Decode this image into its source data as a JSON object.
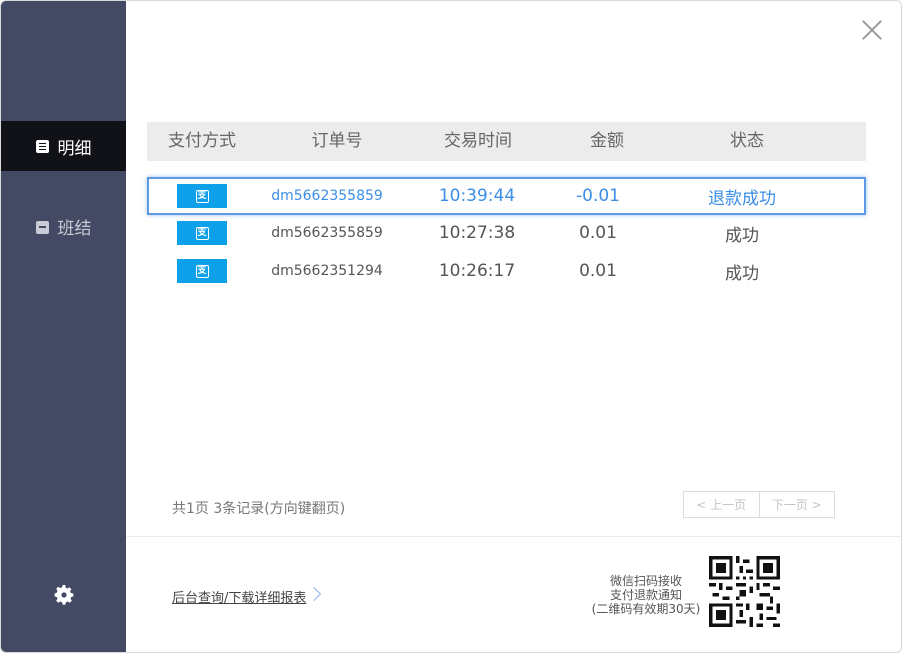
{
  "sidebar": {
    "items": [
      {
        "label": "明细",
        "icon": "document-icon",
        "active": true
      },
      {
        "label": "班结",
        "icon": "calendar-icon",
        "active": false
      }
    ],
    "settings_icon": "gear-icon"
  },
  "table": {
    "headers": [
      "支付方式",
      "订单号",
      "交易时间",
      "金额",
      "状态"
    ],
    "rows": [
      {
        "payment_icon": "alipay-icon",
        "order_no": "dm5662355859",
        "time": "10:39:44",
        "amount": "-0.01",
        "status": "退款成功",
        "selected": true
      },
      {
        "payment_icon": "alipay-icon",
        "order_no": "dm5662355859",
        "time": "10:27:38",
        "amount": "0.01",
        "status": "成功",
        "selected": false
      },
      {
        "payment_icon": "alipay-icon",
        "order_no": "dm5662351294",
        "time": "10:26:17",
        "amount": "0.01",
        "status": "成功",
        "selected": false
      }
    ]
  },
  "summary": "共1页 3条记录(方向键翻页)",
  "pager": {
    "prev": "< 上一页",
    "next": "下一页 >"
  },
  "footer": {
    "report_link": "后台查询/下载详细报表",
    "qr_text": [
      "微信扫码接收",
      "支付退款通知",
      "(二维码有效期30天)"
    ]
  },
  "colors": {
    "sidebar": "#444a64",
    "active_item": "#111217",
    "accent": "#3a8ee6",
    "alipay": "#0ea0e8"
  }
}
